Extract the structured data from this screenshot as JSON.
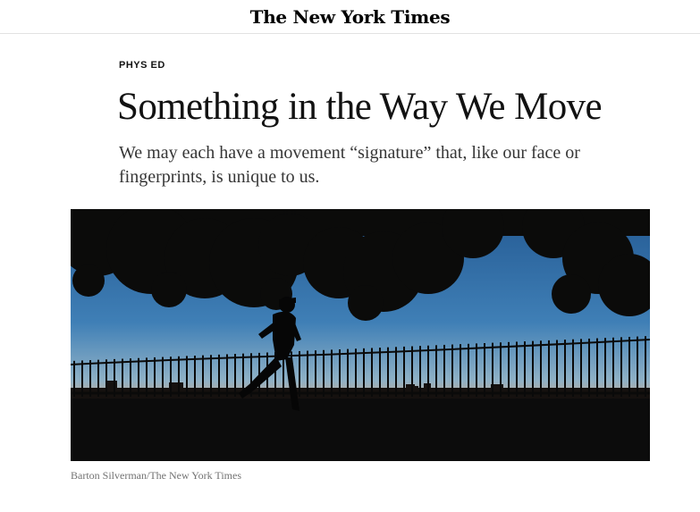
{
  "masthead": {
    "logo_text": "The New York Times"
  },
  "article": {
    "kicker": "PHYS ED",
    "headline": "Something in the Way We Move",
    "summary": "We may each have a movement “signature” that, like our face or fingerprints, is unique to us.",
    "image": {
      "subject": "silhouette-runner-at-dusk",
      "credit": "Barton Silverman/The New York Times"
    }
  },
  "colors": {
    "text": "#121212",
    "summary_text": "#363636",
    "credit_text": "#727272",
    "rule": "#e2e2e2",
    "sky_top": "#2f6aa6",
    "sky_horizon": "#e8a36a"
  }
}
